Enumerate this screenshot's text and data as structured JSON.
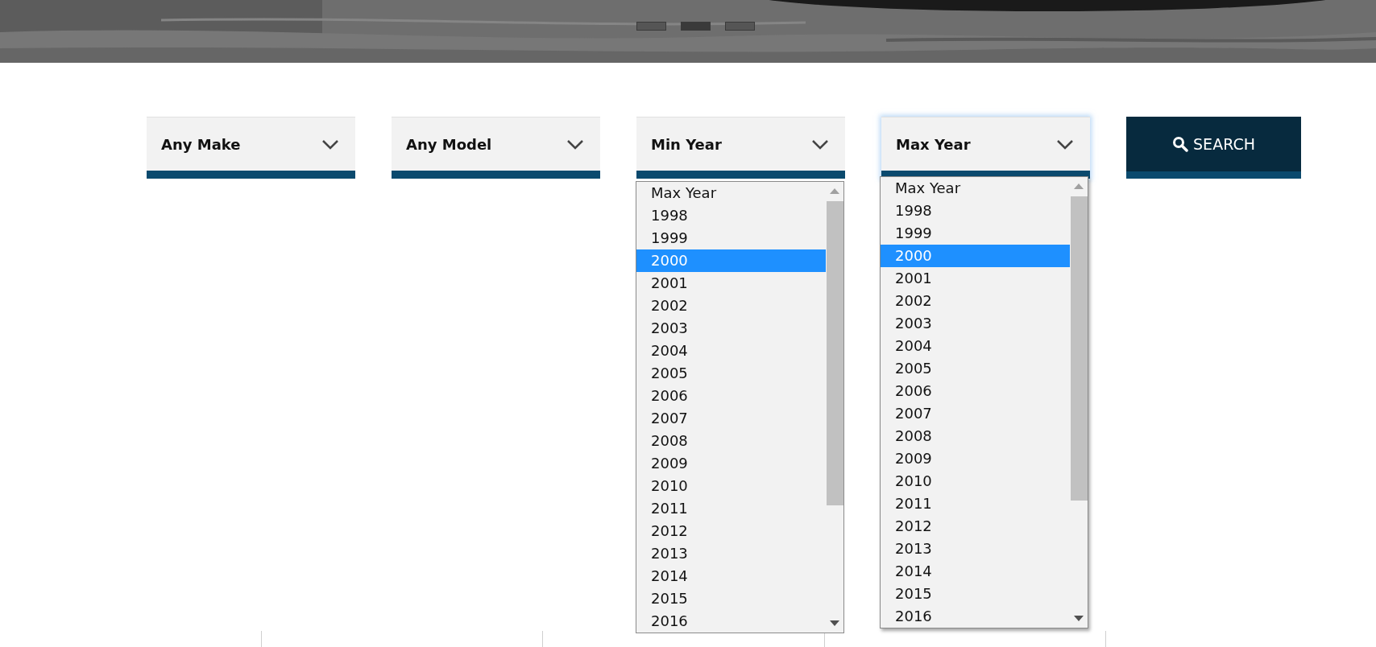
{
  "banner": {
    "kind": "picture",
    "slides": [
      {
        "selected": false
      },
      {
        "selected": true
      },
      {
        "selected": false
      }
    ]
  },
  "filters": [
    {
      "label": "Any Make",
      "focused": false
    },
    {
      "label": "Any Model",
      "focused": false
    },
    {
      "label": "Min Year",
      "focused": false
    },
    {
      "label": "Max Year",
      "focused": true
    }
  ],
  "search_button": {
    "label": "SEARCH"
  },
  "dropdowns": [
    {
      "options": [
        {
          "label": "Max Year",
          "selected": false
        },
        {
          "label": "1998",
          "selected": false
        },
        {
          "label": "1999",
          "selected": false
        },
        {
          "label": "2000",
          "selected": true
        },
        {
          "label": "2001",
          "selected": false
        },
        {
          "label": "2002",
          "selected": false
        },
        {
          "label": "2003",
          "selected": false
        },
        {
          "label": "2004",
          "selected": false
        },
        {
          "label": "2005",
          "selected": false
        },
        {
          "label": "2006",
          "selected": false
        },
        {
          "label": "2007",
          "selected": false
        },
        {
          "label": "2008",
          "selected": false
        },
        {
          "label": "2009",
          "selected": false
        },
        {
          "label": "2010",
          "selected": false
        },
        {
          "label": "2011",
          "selected": false
        },
        {
          "label": "2012",
          "selected": false
        },
        {
          "label": "2013",
          "selected": false
        },
        {
          "label": "2014",
          "selected": false
        },
        {
          "label": "2015",
          "selected": false
        },
        {
          "label": "2016",
          "selected": false
        }
      ]
    },
    {
      "options": [
        {
          "label": "Max Year",
          "selected": false
        },
        {
          "label": "1998",
          "selected": false
        },
        {
          "label": "1999",
          "selected": false
        },
        {
          "label": "2000",
          "selected": true
        },
        {
          "label": "2001",
          "selected": false
        },
        {
          "label": "2002",
          "selected": false
        },
        {
          "label": "2003",
          "selected": false
        },
        {
          "label": "2004",
          "selected": false
        },
        {
          "label": "2005",
          "selected": false
        },
        {
          "label": "2006",
          "selected": false
        },
        {
          "label": "2007",
          "selected": false
        },
        {
          "label": "2008",
          "selected": false
        },
        {
          "label": "2009",
          "selected": false
        },
        {
          "label": "2010",
          "selected": false
        },
        {
          "label": "2011",
          "selected": false
        },
        {
          "label": "2012",
          "selected": false
        },
        {
          "label": "2013",
          "selected": false
        },
        {
          "label": "2014",
          "selected": false
        },
        {
          "label": "2015",
          "selected": false
        },
        {
          "label": "2016",
          "selected": false
        }
      ]
    }
  ]
}
